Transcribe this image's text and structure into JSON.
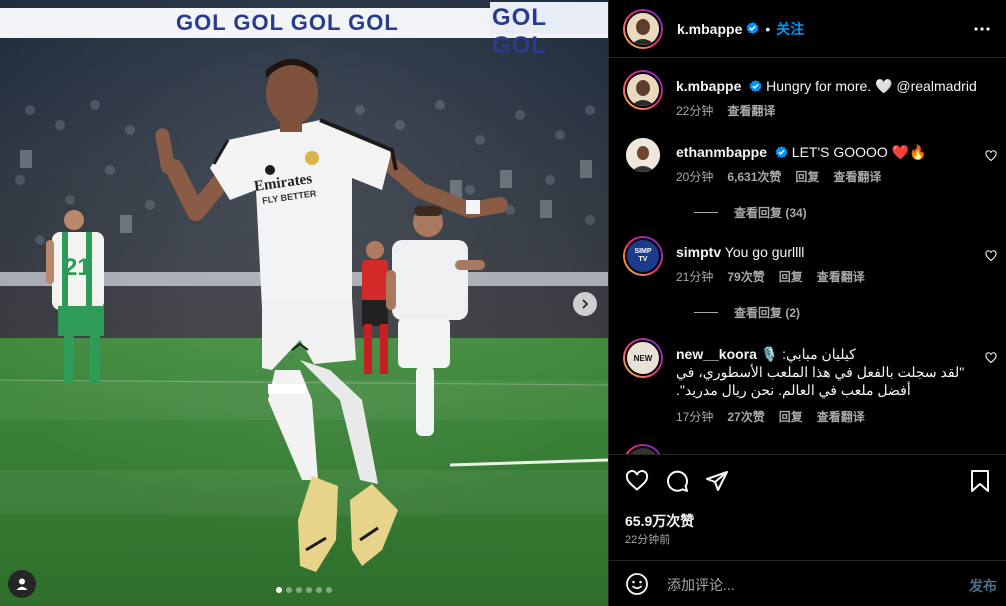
{
  "media": {
    "banner_text": "GOL GOL GOL GOL",
    "banner_text_right": "GOL GOL",
    "jersey_sponsor": "Emirates",
    "jersey_sponsor_sub": "FLY BETTER",
    "bg_player_number": "21",
    "carousel_dots": 6,
    "active_dot": 0
  },
  "header": {
    "username": "k.mbappe",
    "verified": true,
    "separator": "•",
    "follow_label": "关注",
    "more_icon": "more-horizontal-icon"
  },
  "caption": {
    "username": "k.mbappe",
    "text": "Hungry for more. 🤍 @realmadrid",
    "time": "22分钟",
    "translate": "查看翻译"
  },
  "comments": [
    {
      "username": "ethanmbappe",
      "verified": true,
      "text": "LET'S GOOOO ❤️🔥",
      "time": "20分钟",
      "likes": "6,631次赞",
      "reply": "回复",
      "translate": "查看翻译",
      "view_replies": "查看回复 (34)"
    },
    {
      "username": "simptv",
      "verified": false,
      "avatar_text": "SIMP TV",
      "text": "You go gurllll",
      "time": "21分钟",
      "likes": "79次赞",
      "reply": "回复",
      "translate": "查看翻译",
      "view_replies": "查看回复 (2)"
    },
    {
      "username": "new__koora",
      "verified": false,
      "avatar_text": "NEW",
      "text_line1": "كيليان مبابي: 🎙️",
      "text_line2": "\"لقد سجلت بالفعل في هذا الملعب الأسطوري، في",
      "text_line3": "أفضل ملعب في العالم. نحن ريال مدريد\".",
      "time": "17分钟",
      "likes": "27次赞",
      "reply": "回复",
      "translate": "查看翻译"
    }
  ],
  "actions": {
    "like_icon": "heart-icon",
    "comment_icon": "comment-icon",
    "share_icon": "send-icon",
    "save_icon": "bookmark-icon",
    "likes": "65.9万次赞",
    "time": "22分钟前"
  },
  "add_comment": {
    "placeholder": "添加评论...",
    "post_label": "发布",
    "emoji_icon": "emoji-icon"
  },
  "colors": {
    "accent": "#0095f6",
    "verified": "#0095f6",
    "heart_red": "#ed4956",
    "muted": "#a8a8a8"
  }
}
